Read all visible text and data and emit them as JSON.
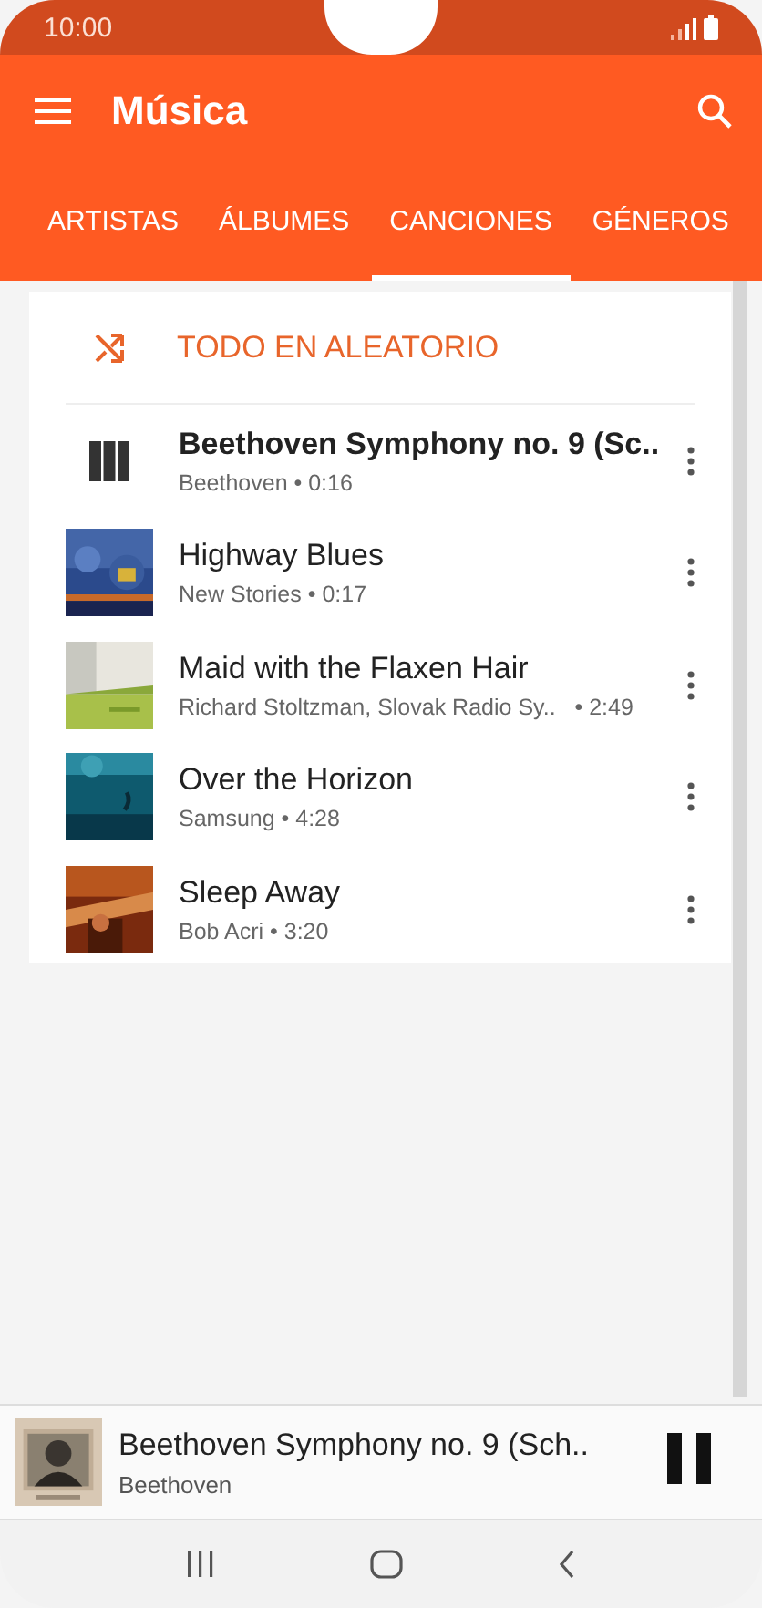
{
  "status_bar": {
    "time": "10:00"
  },
  "app_bar": {
    "title": "Música"
  },
  "tabs": [
    {
      "label": "ARTISTAS",
      "selected": false
    },
    {
      "label": "ÁLBUMES",
      "selected": false
    },
    {
      "label": "CANCIONES",
      "selected": true
    },
    {
      "label": "GÉNEROS",
      "selected": false
    }
  ],
  "shuffle": {
    "label": "TODO EN ALEATORIO"
  },
  "songs": [
    {
      "kind": "playing",
      "title": "Beethoven Symphony no. 9 (Sc..",
      "subtitle": "Beethoven • 0:16"
    },
    {
      "kind": "art",
      "title": "Highway Blues",
      "subtitle": "New Stories • 0:17"
    },
    {
      "kind": "art",
      "title": "Maid with the Flaxen Hair",
      "subtitle": "Richard Stoltzman, Slovak Radio Sy..   • 2:49"
    },
    {
      "kind": "art",
      "title": "Over the Horizon",
      "subtitle": "Samsung • 4:28"
    },
    {
      "kind": "art",
      "title": "Sleep Away",
      "subtitle": "Bob Acri • 3:20"
    }
  ],
  "mini_player": {
    "title": "Beethoven Symphony no. 9 (Sch..",
    "artist": "Beethoven",
    "playing": true
  }
}
